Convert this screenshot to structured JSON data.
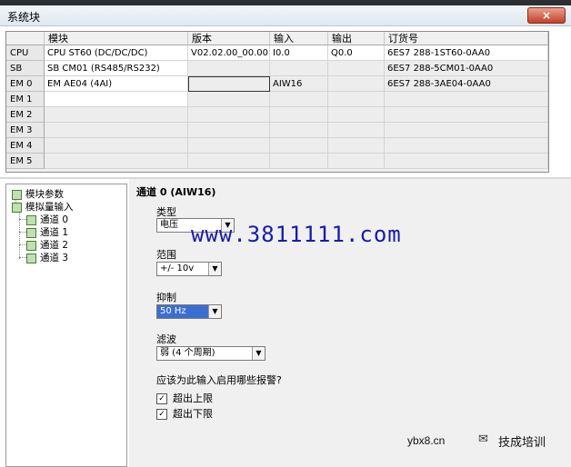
{
  "window": {
    "title": "系统块",
    "close_icon": "×"
  },
  "table": {
    "headers": [
      "模块",
      "版本",
      "输入",
      "输出",
      "订货号"
    ],
    "rows": [
      {
        "label": "CPU",
        "module": "CPU ST60 (DC/DC/DC)",
        "version": "V02.02.00_00.00...",
        "input": "I0.0",
        "output": "Q0.0",
        "order": "6ES7 288-1ST60-0AA0"
      },
      {
        "label": "SB",
        "module": "SB CM01 (RS485/RS232)",
        "version": "",
        "input": "",
        "output": "",
        "order": "6ES7 288-5CM01-0AA0"
      },
      {
        "label": "EM 0",
        "module": "EM AE04 (4AI)",
        "version": "",
        "input": "AIW16",
        "output": "",
        "order": "6ES7 288-3AE04-0AA0"
      },
      {
        "label": "EM 1",
        "module": "",
        "version": "",
        "input": "",
        "output": "",
        "order": ""
      },
      {
        "label": "EM 2",
        "module": "",
        "version": "",
        "input": "",
        "output": "",
        "order": ""
      },
      {
        "label": "EM 3",
        "module": "",
        "version": "",
        "input": "",
        "output": "",
        "order": ""
      },
      {
        "label": "EM 4",
        "module": "",
        "version": "",
        "input": "",
        "output": "",
        "order": ""
      },
      {
        "label": "EM 5",
        "module": "",
        "version": "",
        "input": "",
        "output": "",
        "order": ""
      }
    ]
  },
  "tree": {
    "items": [
      "模块参数",
      "模拟量输入",
      "通道 0",
      "通道 1",
      "通道 2",
      "通道 3"
    ]
  },
  "properties": {
    "title": "通道 0 (AIW16)",
    "type_label": "类型",
    "type_value": "电压",
    "range_label": "范围",
    "range_value": "+/- 10v",
    "suppression_label": "抑制",
    "suppression_value": "50 Hz",
    "filter_label": "滤波",
    "filter_value": "弱 (4 个周期)",
    "alarm_question": "应该为此输入启用哪些报警?",
    "alarm_upper": "超出上限",
    "alarm_lower": "超出下限",
    "check_mark": "✓"
  },
  "watermarks": {
    "main": "www.3811111.com",
    "site": "ybx8.cn",
    "brand": "技成培训"
  }
}
